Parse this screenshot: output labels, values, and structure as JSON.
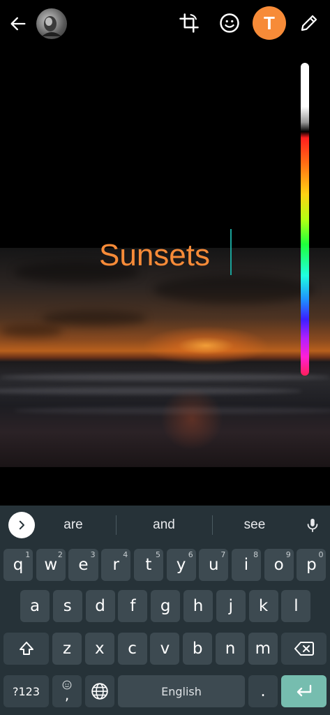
{
  "toolbar": {
    "icons": [
      "back-arrow-icon",
      "avatar",
      "crop-rotate-icon",
      "emoji-icon",
      "text-icon",
      "pencil-icon"
    ],
    "text_tool_label": "T",
    "text_tool_color": "#f78b38"
  },
  "canvas": {
    "overlay_text": "Sunsets",
    "overlay_text_color": "#f78b38",
    "cursor_color": "#1aa39a"
  },
  "keyboard": {
    "suggestions": [
      "are",
      "and",
      "see"
    ],
    "rows": [
      [
        {
          "k": "q",
          "h": "1"
        },
        {
          "k": "w",
          "h": "2"
        },
        {
          "k": "e",
          "h": "3"
        },
        {
          "k": "r",
          "h": "4"
        },
        {
          "k": "t",
          "h": "5"
        },
        {
          "k": "y",
          "h": "6"
        },
        {
          "k": "u",
          "h": "7"
        },
        {
          "k": "i",
          "h": "8"
        },
        {
          "k": "o",
          "h": "9"
        },
        {
          "k": "p",
          "h": "0"
        }
      ],
      [
        {
          "k": "a"
        },
        {
          "k": "s"
        },
        {
          "k": "d"
        },
        {
          "k": "f"
        },
        {
          "k": "g"
        },
        {
          "k": "h"
        },
        {
          "k": "j"
        },
        {
          "k": "k"
        },
        {
          "k": "l"
        }
      ],
      [
        {
          "k": "z"
        },
        {
          "k": "x"
        },
        {
          "k": "c"
        },
        {
          "k": "v"
        },
        {
          "k": "b"
        },
        {
          "k": "n"
        },
        {
          "k": "m"
        }
      ]
    ],
    "symbols_label": "?123",
    "comma_label": ",",
    "space_label": "English",
    "period_label": ".",
    "shift_icon": "shift-icon",
    "backspace_icon": "backspace-icon",
    "enter_icon": "enter-icon",
    "globe_icon": "globe-icon",
    "mic_icon": "mic-icon",
    "expand_icon": "chevron-right-icon",
    "enter_color": "#76bdaf",
    "background_color": "#263238"
  }
}
